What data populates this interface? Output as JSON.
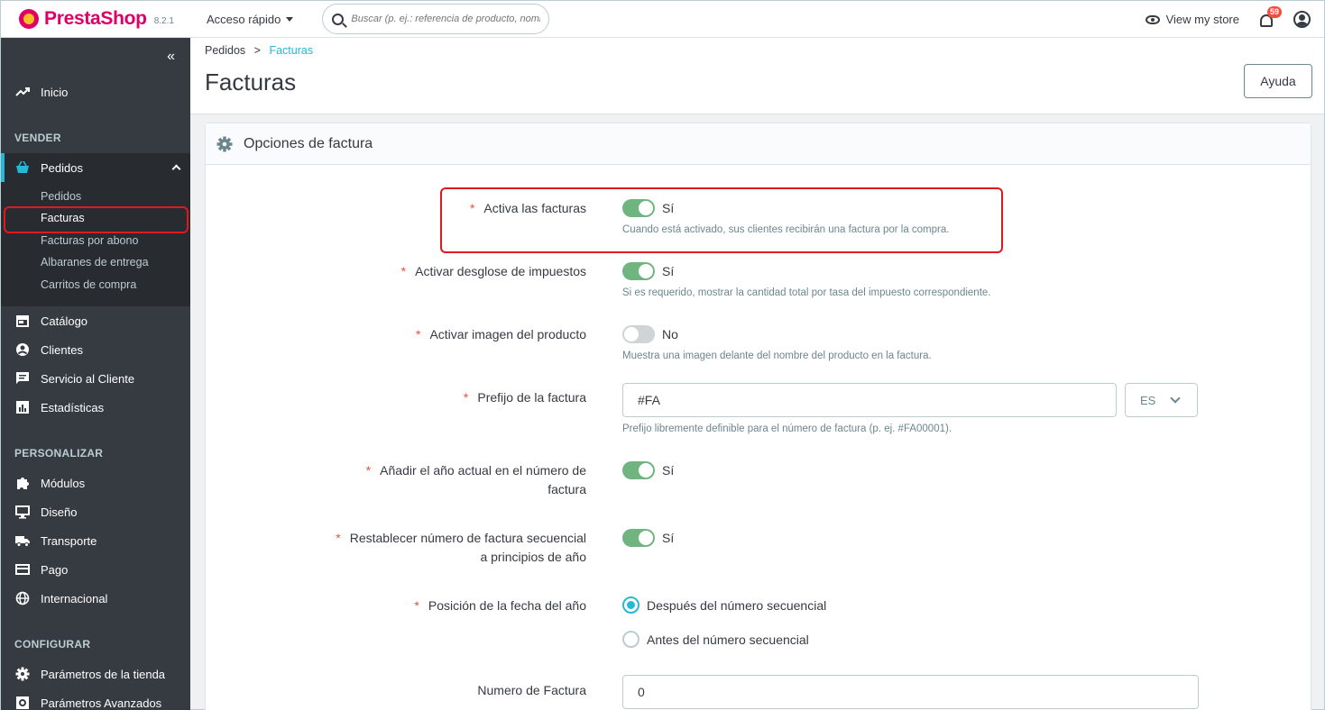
{
  "header": {
    "brand": "PrestaShop",
    "version": "8.2.1",
    "quick_access": "Acceso rápido",
    "search_placeholder": "Buscar (p. ej.: referencia de producto, nombre de cliente...)",
    "view_store": "View my store",
    "notifications_count": "59"
  },
  "sidebar": {
    "collapse": "«",
    "home": "Inicio",
    "sections": {
      "sell": "VENDER",
      "customize": "PERSONALIZAR",
      "configure": "CONFIGURAR"
    },
    "orders": "Pedidos",
    "orders_sub": [
      "Pedidos",
      "Facturas",
      "Facturas por abono",
      "Albaranes de entrega",
      "Carritos de compra"
    ],
    "sell_items": [
      "Catálogo",
      "Clientes",
      "Servicio al Cliente",
      "Estadísticas"
    ],
    "customize_items": [
      "Módulos",
      "Diseño",
      "Transporte",
      "Pago",
      "Internacional"
    ],
    "configure_items": [
      "Parámetros de la tienda",
      "Parámetros Avanzados"
    ],
    "accent": "#25b9d7"
  },
  "page": {
    "breadcrumb_parent": "Pedidos",
    "breadcrumb_sep": ">",
    "breadcrumb_current": "Facturas",
    "title": "Facturas",
    "help": "Ayuda"
  },
  "card": {
    "title": "Opciones de factura",
    "required_mark": "*",
    "enable_invoices": {
      "label": "Activa las facturas",
      "value": "Sí",
      "on": true,
      "hint": "Cuando está activado, sus clientes recibirán una factura por la compra."
    },
    "tax_breakdown": {
      "label": "Activar desglose de impuestos",
      "value": "Sí",
      "on": true,
      "hint": "Si es requerido, mostrar la cantidad total por tasa del impuesto correspondiente."
    },
    "product_image": {
      "label": "Activar imagen del producto",
      "value": "No",
      "on": false,
      "hint": "Muestra una imagen delante del nombre del producto en la factura."
    },
    "prefix": {
      "label": "Prefijo de la factura",
      "value": "#FA",
      "lang": "ES",
      "hint": "Prefijo libremente definible para el número de factura (p. ej. #FA00001)."
    },
    "add_year": {
      "label_line1": "Añadir el año actual en el número de",
      "label_line2": "factura",
      "value": "Sí",
      "on": true
    },
    "reset_seq": {
      "label_line1": "Restablecer número de factura secuencial",
      "label_line2": "a principios de año",
      "value": "Sí",
      "on": true
    },
    "year_position": {
      "label": "Posición de la fecha del año",
      "options": [
        "Después del número secuencial",
        "Antes del número secuencial"
      ],
      "selected": 0
    },
    "invoice_number": {
      "label": "Numero de Factura",
      "value": "0"
    }
  }
}
